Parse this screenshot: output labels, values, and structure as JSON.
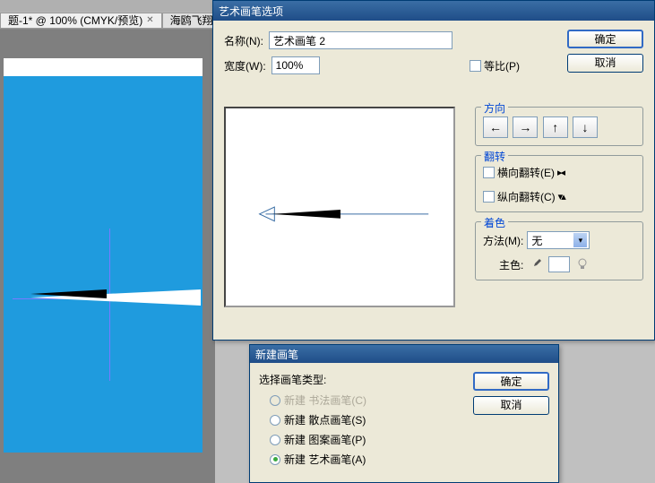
{
  "tabs": {
    "canvas_tab": "题-1* @ 100% (CMYK/预览)",
    "file_tab": "海鸥飞翔. a..."
  },
  "dialog1": {
    "title": "艺术画笔选项",
    "name_label": "名称(N):",
    "name_value": "艺术画笔 2",
    "width_label": "宽度(W):",
    "width_value": "100%",
    "proportional_label": "等比(P)",
    "ok": "确定",
    "cancel": "取消",
    "direction": {
      "legend": "方向",
      "left": "←",
      "right": "→",
      "up": "↑",
      "down": "↓"
    },
    "flip": {
      "legend": "翻转",
      "horizontal": "横向翻转(E)",
      "vertical": "纵向翻转(C)"
    },
    "colorize": {
      "legend": "着色",
      "method_label": "方法(M):",
      "method_value": "无",
      "keycolor_label": "主色:"
    }
  },
  "dialog2": {
    "title": "新建画笔",
    "prompt": "选择画笔类型:",
    "opt_calligraphy": "新建 书法画笔(C)",
    "opt_scatter": "新建 散点画笔(S)",
    "opt_pattern": "新建 图案画笔(P)",
    "opt_art": "新建 艺术画笔(A)",
    "ok": "确定",
    "cancel": "取消"
  }
}
